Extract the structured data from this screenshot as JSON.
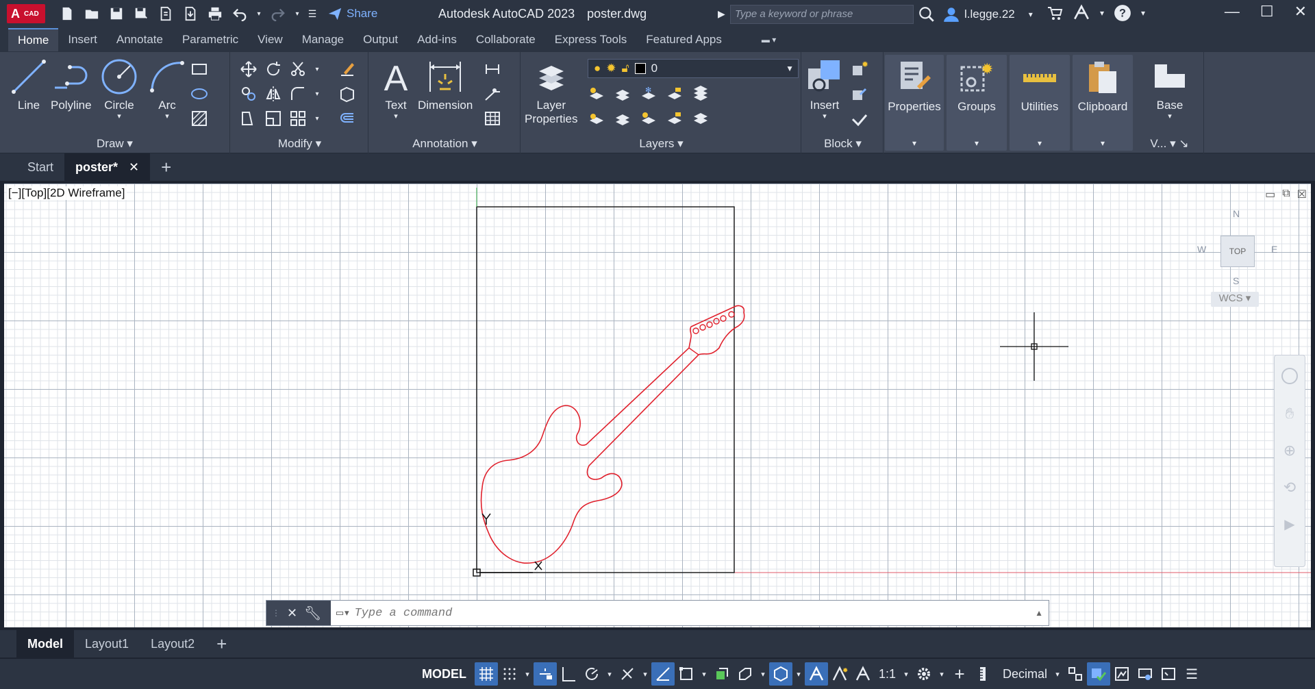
{
  "titlebar": {
    "logo_main": "A",
    "logo_sub": "CAD",
    "share": "Share",
    "app_name": "Autodesk AutoCAD 2023",
    "file_name": "poster.dwg",
    "search_placeholder": "Type a keyword or phrase",
    "user": "l.legge.22"
  },
  "ribbon_tabs": [
    "Home",
    "Insert",
    "Annotate",
    "Parametric",
    "View",
    "Manage",
    "Output",
    "Add-ins",
    "Collaborate",
    "Express Tools",
    "Featured Apps"
  ],
  "ribbon": {
    "draw": {
      "title": "Draw",
      "line": "Line",
      "polyline": "Polyline",
      "circle": "Circle",
      "arc": "Arc"
    },
    "modify": {
      "title": "Modify"
    },
    "annotation": {
      "title": "Annotation",
      "text": "Text",
      "dimension": "Dimension"
    },
    "layers": {
      "title": "Layers",
      "layer_properties_1": "Layer",
      "layer_properties_2": "Properties",
      "current_layer": "0"
    },
    "block": {
      "title": "Block",
      "insert": "Insert"
    },
    "properties": "Properties",
    "groups": "Groups",
    "utilities": "Utilities",
    "clipboard": "Clipboard",
    "base": "Base",
    "view_short": "V..."
  },
  "doc_tabs": {
    "start": "Start",
    "active": "poster*"
  },
  "viewport": {
    "label": "[−][Top][2D Wireframe]",
    "compass": {
      "n": "N",
      "s": "S",
      "e": "E",
      "w": "W"
    },
    "cube_face": "TOP",
    "wcs": "WCS"
  },
  "command": {
    "placeholder": "Type a command"
  },
  "layout_tabs": [
    "Model",
    "Layout1",
    "Layout2"
  ],
  "status": {
    "model": "MODEL",
    "scale": "1:1",
    "units": "Decimal"
  },
  "colors": {
    "accent": "#3a6fb8",
    "drawing_red": "#e0202c",
    "logo_red": "#c8102e"
  }
}
